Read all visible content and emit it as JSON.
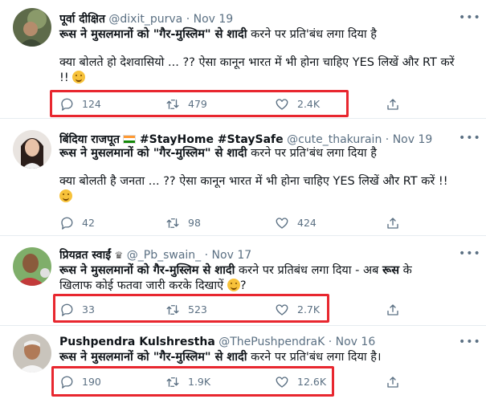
{
  "tweets": [
    {
      "name": "पूर्वा दीक्षित",
      "handle": "@dixit_purva",
      "dot": "·",
      "date": "Nov 19",
      "line1_bold": "रूस ने मुसलमानों को \"गैर-मुस्लिम\" से शादी",
      "line1_rest": " करने पर प्रति'बंध लगा दिया है",
      "line2": "क्या बोलते हो देशवासियो ... ?? ऐसा कानून भारत में भी होना चाहिए YES लिखें और RT करें",
      "line3": "!!",
      "reply_count": "124",
      "retweet_count": "479",
      "like_count": "2.4K"
    },
    {
      "name": "बिंदिया राजपूत",
      "handle_tags": "#StayHome #StaySafe",
      "handle": "@cute_thakurain",
      "dot": "·",
      "date": "Nov 19",
      "line1_bold": "रूस ने मुसलमानों को \"गैर-मुस्लिम\" से शादी",
      "line1_rest": " करने पर प्रति'बंध लगा दिया है",
      "line2": "क्या बोलती है जनता ... ?? ऐसा कानून भारत में भी होना चाहिए YES लिखें और RT करें !!",
      "reply_count": "42",
      "retweet_count": "98",
      "like_count": "424"
    },
    {
      "name": "प्रियव्रत स्वाईं",
      "crown": "♛",
      "handle": "@_Pb_swain_",
      "dot": "·",
      "date": "Nov 17",
      "line1_bold": "रूस ने मुसलमानों को गैर-मुस्लिम से शादी",
      "line1_rest": " करने पर प्रतिबंध लगा दिया - अब ",
      "line1_bold2": "रूस",
      "line1_rest2": " के",
      "line2": "खिलाफ कोई फतवा जारी करके दिखाऐं",
      "line2_end": "?",
      "reply_count": "33",
      "retweet_count": "523",
      "like_count": "2.7K"
    },
    {
      "name": "Pushpendra Kulshrestha",
      "handle": "@ThePushpendraK",
      "dot": "·",
      "date": "Nov 16",
      "line1_bold": "रूस ने मुसलमानों को \"गैर-मुस्लिम\" से शादी",
      "line1_rest": " करने पर प्रति'बंध लगा दिया है।",
      "reply_count": "190",
      "retweet_count": "1.9K",
      "like_count": "12.6K"
    }
  ],
  "ui": {
    "more_glyph": "•••"
  },
  "colors": {
    "text": "#0f1419",
    "muted": "#5b7083",
    "highlight": "#e8272f",
    "border": "#e6ecf0"
  }
}
